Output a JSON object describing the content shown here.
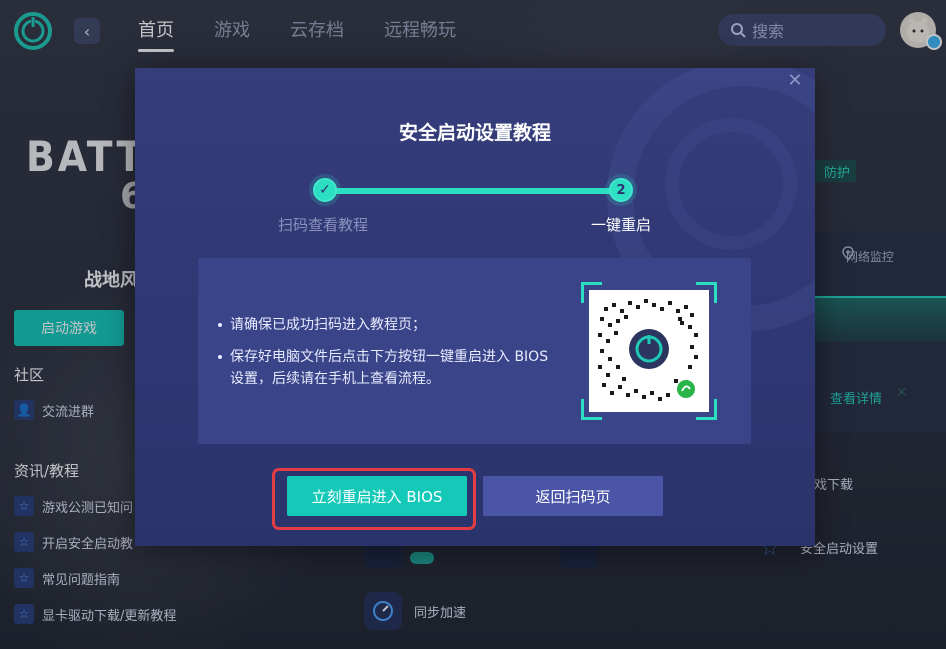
{
  "nav": {
    "tabs": [
      {
        "label": "首页",
        "active": true
      },
      {
        "label": "游戏",
        "active": false
      },
      {
        "label": "云存档",
        "active": false
      },
      {
        "label": "远程畅玩",
        "active": false
      }
    ],
    "search_placeholder": "搜索",
    "back_icon": "chevron-left-icon"
  },
  "game": {
    "title": "BATTLE",
    "title_num": "6",
    "name_cn": "战地风",
    "start_button": "启动游戏"
  },
  "sidebar": {
    "community_label": "社区",
    "community_items": [
      {
        "label": "交流进群",
        "icon": "user-group-icon"
      }
    ],
    "news_label": "资讯/教程",
    "news_items": [
      {
        "label": "游戏公测已知问",
        "icon": "star-icon"
      },
      {
        "label": "开启安全启动教",
        "icon": "star-icon"
      },
      {
        "label": "常见问题指南",
        "icon": "star-icon"
      },
      {
        "label": "显卡驱动下载/更新教程",
        "icon": "star-icon"
      }
    ]
  },
  "right": {
    "badge": "防护",
    "net_label": "网络监控",
    "detail_link": "查看详情",
    "download_text": "戏下载",
    "secure_boot_text": "安全启动设置",
    "sync_text": "同步加速"
  },
  "modal": {
    "title": "安全启动设置教程",
    "steps": [
      {
        "label": "扫码查看教程",
        "marker": "✓",
        "done": true
      },
      {
        "label": "一键重启",
        "marker": "2",
        "done": false
      }
    ],
    "bullets": [
      "请确保已成功扫码进入教程页；",
      "保存好电脑文件后点击下方按钮一键重启进入 BIOS 设置，后续请在手机上查看流程。"
    ],
    "primary_button": "立刻重启进入 BIOS",
    "secondary_button": "返回扫码页",
    "close_icon": "close-icon",
    "qr_icon": "qr-code-icon"
  },
  "colors": {
    "accent": "#14c9b8",
    "modal_bg": "#2f3873",
    "highlight": "#e23c44"
  }
}
